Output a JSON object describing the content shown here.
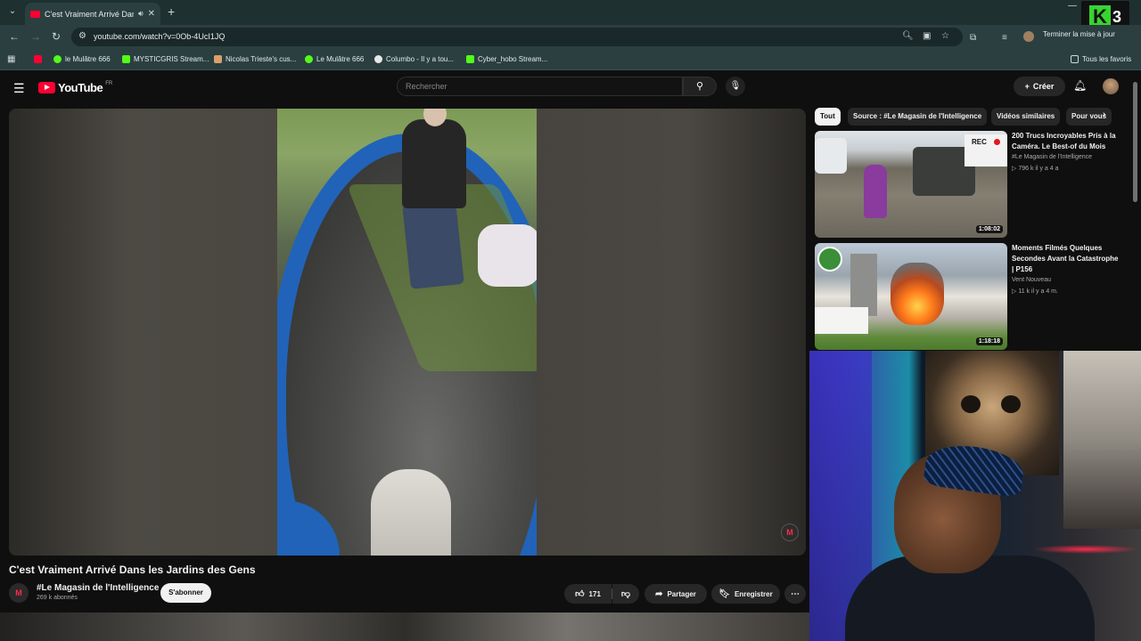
{
  "browser": {
    "tab_title": "C'est Vraiment Arrivé Dans l",
    "url": "youtube.com/watch?v=0Ob-4UcI1JQ",
    "update_label": "Terminer la mise à jour",
    "bookmarks": [
      {
        "label": "",
        "color": "#ff0033"
      },
      {
        "label": "le Mulâtre 666",
        "color": "#53fc18"
      },
      {
        "label": "MYSTICGRIS Stream...",
        "color": "#53fc18"
      },
      {
        "label": "Nicolas Trieste's cus...",
        "color": "#d9a06b"
      },
      {
        "label": "Le Mulâtre 666",
        "color": "#53fc18"
      },
      {
        "label": "Columbo - Il y a tou...",
        "color": "#e8e8e8"
      },
      {
        "label": "Cyber_hobo Stream...",
        "color": "#53fc18"
      }
    ],
    "all_bookmarks_label": "Tous les favoris"
  },
  "overlay": {
    "k_letter": "K",
    "k_number": "3"
  },
  "youtube": {
    "logo_text": "YouTube",
    "logo_region": "FR",
    "search_placeholder": "Rechercher",
    "create_label": "Créer"
  },
  "video": {
    "title": "C'est Vraiment Arrivé Dans les Jardins des Gens",
    "channel": "#Le Magasin de l'Intelligence",
    "subscribers": "269 k abonnés",
    "subscribe_label": "S'abonner",
    "likes": "171",
    "share_label": "Partager",
    "save_label": "Enregistrer"
  },
  "sidebar": {
    "chips": [
      {
        "label": "Tout",
        "active": true
      },
      {
        "label": "Source : #Le Magasin de l'Intelligence",
        "active": false
      },
      {
        "label": "Vidéos similaires",
        "active": false
      },
      {
        "label": "Pour vous",
        "active": false
      }
    ],
    "recommendations": [
      {
        "title": "200 Trucs Incroyables Pris à la Caméra. Le Best-of du Mois",
        "channel": "#Le Magasin de l'Intelligence",
        "meta": "▷ 796 k  il y a 4 a",
        "duration": "1:08:02",
        "rec_label": "REC"
      },
      {
        "title": "Moments Filmés Quelques Secondes Avant la Catastrophe | P156",
        "channel": "Vent Nouveau",
        "meta": "▷ 11 k  il y a 4 m.",
        "duration": "1:18:18"
      }
    ]
  },
  "colors": {
    "accent": "#ff0033",
    "background": "#0f0f0f",
    "browser_chrome": "#2b3f40"
  }
}
